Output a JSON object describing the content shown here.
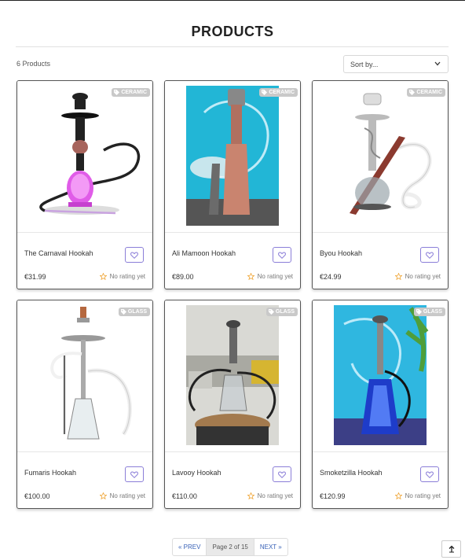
{
  "page": {
    "title": "PRODUCTS",
    "count_text": "6 Products"
  },
  "sort": {
    "label": "Sort by..."
  },
  "products": [
    {
      "name": "The Carnaval Hookah",
      "price": "€31.99",
      "badge": "CERAMIC",
      "rating": "No rating yet"
    },
    {
      "name": "Ali Mamoon Hookah",
      "price": "€89.00",
      "badge": "CERAMIC",
      "rating": "No rating yet"
    },
    {
      "name": "Byou Hookah",
      "price": "€24.99",
      "badge": "CERAMIC",
      "rating": "No rating yet"
    },
    {
      "name": "Fumaris Hookah",
      "price": "€100.00",
      "badge": "GLASS",
      "rating": "No rating yet"
    },
    {
      "name": "Lavooy Hookah",
      "price": "€110.00",
      "badge": "GLASS",
      "rating": "No rating yet"
    },
    {
      "name": "Smoketzilla Hookah",
      "price": "€120.99",
      "badge": "GLASS",
      "rating": "No rating yet"
    }
  ],
  "pagination": {
    "prev": "« PREV",
    "current": "Page 2 of 15",
    "next": "NEXT »"
  },
  "colors": {
    "accent": "#8b7ed8",
    "link": "#3a63b8",
    "star": "#f0a83c",
    "badge": "#c9c9c9"
  },
  "icons": {
    "badge": "tag-icon",
    "wishlist": "heart-icon",
    "rating": "star-icon",
    "sort": "chevron-down-icon",
    "back_to_top": "arrow-up-icon"
  }
}
